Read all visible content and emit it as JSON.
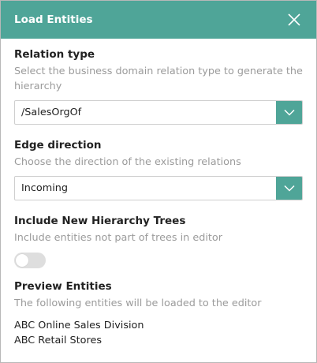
{
  "dialog": {
    "title": "Load Entities"
  },
  "relation_type": {
    "label": "Relation type",
    "description": "Select the business domain relation type to generate the hierarchy",
    "selected": "/SalesOrgOf"
  },
  "edge_direction": {
    "label": "Edge direction",
    "description": "Choose the direction of the existing relations",
    "selected": "Incoming"
  },
  "include_trees": {
    "label": "Include New Hierarchy Trees",
    "description": "Include entities not part of trees in editor",
    "enabled": false
  },
  "preview": {
    "label": "Preview Entities",
    "description": "The following entities will be loaded to the editor",
    "entities": [
      "ABC Online Sales Division",
      "ABC Retail Stores"
    ]
  },
  "colors": {
    "accent": "#4fa598",
    "muted_text": "#9b9b9b"
  },
  "icons": {
    "close": "close-icon",
    "dropdown": "chevron-down-icon"
  }
}
